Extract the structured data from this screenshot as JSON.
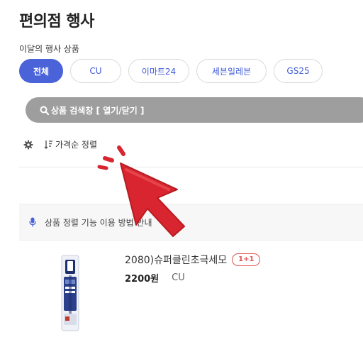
{
  "header": {
    "title": "편의점 행사"
  },
  "section": {
    "label": "이달의 행사 상품"
  },
  "chips": [
    {
      "label": "전체",
      "active": true
    },
    {
      "label": "CU",
      "active": false
    },
    {
      "label": "이마트24",
      "active": false
    },
    {
      "label": "세븐일레븐",
      "active": false
    },
    {
      "label": "GS25",
      "active": false
    }
  ],
  "search": {
    "label": "상품 검색창 [ 열기/닫기 ]",
    "icon": "search-icon"
  },
  "sort": {
    "label": "가격순 정렬",
    "icons": [
      "gear-icon",
      "sort-icon"
    ]
  },
  "notice": {
    "text": "상품 정렬 기능 이용 방법 안내",
    "icon": "microphone-icon"
  },
  "products": [
    {
      "name": "2080)슈퍼클린초극세모",
      "badge": "1+1",
      "price": "2200원",
      "store": "CU"
    }
  ],
  "colors": {
    "accent": "#4a63d8",
    "search_bar": "#9e9e9e",
    "badge": "#e05555",
    "cursor": "#d8252f"
  }
}
